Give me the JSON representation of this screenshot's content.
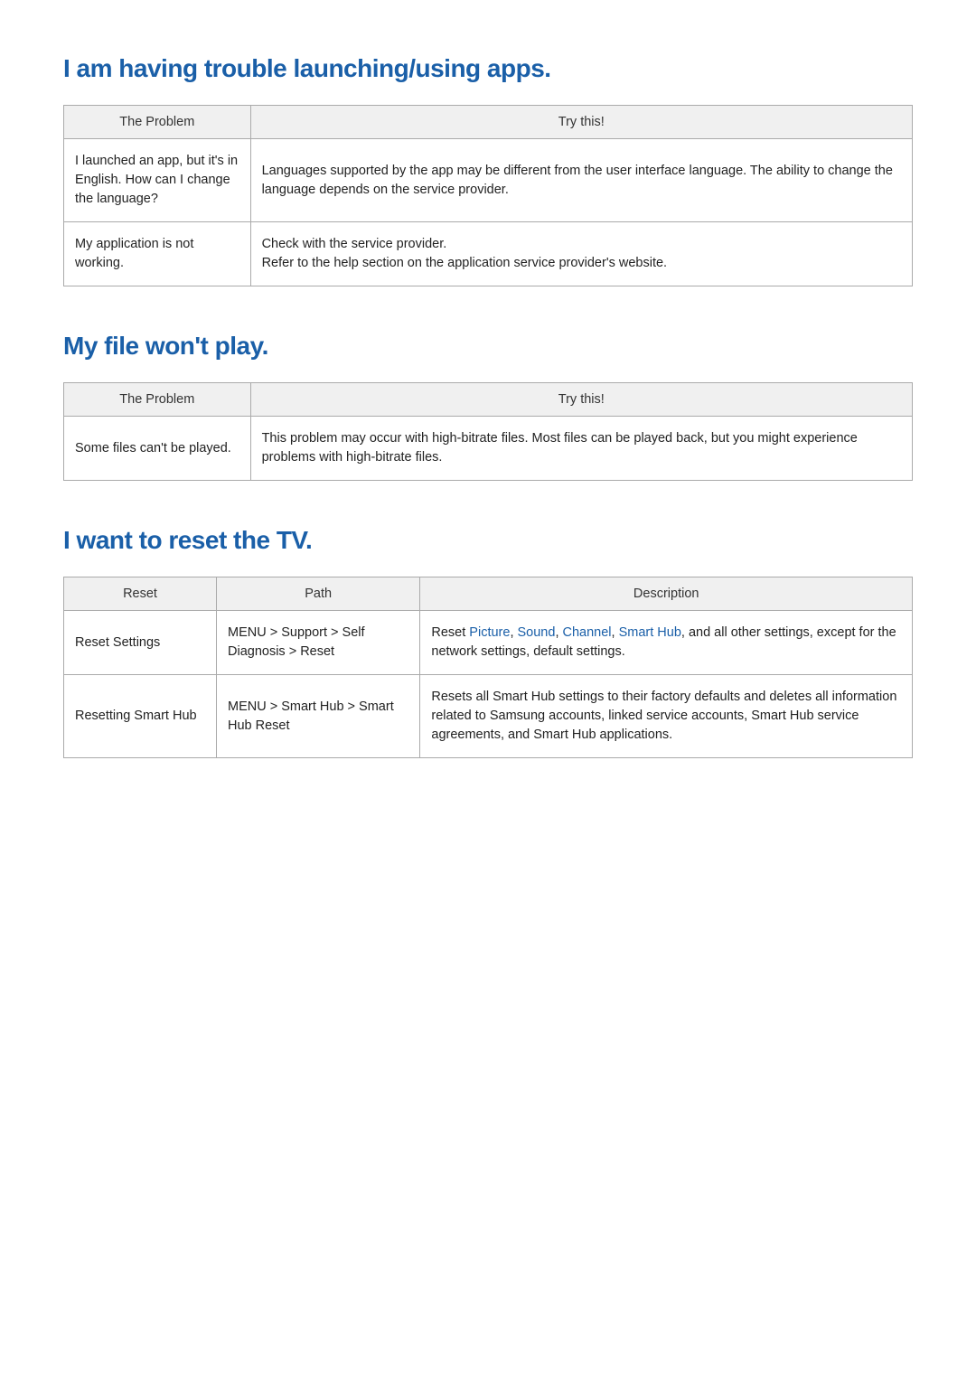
{
  "sections": {
    "apps": {
      "heading": "I am having trouble launching/using apps.",
      "headers": [
        "The Problem",
        "Try this!"
      ],
      "rows": [
        {
          "problem": "I launched an app, but it's in English. How can I change the language?",
          "solution": "Languages supported by the app may be different from the user interface language. The ability to change the language depends on the service provider."
        },
        {
          "problem": "My application is not working.",
          "solution": "Check with the service provider.\nRefer to the help section on the application service provider's website."
        }
      ]
    },
    "file": {
      "heading": "My file won't play.",
      "headers": [
        "The Problem",
        "Try this!"
      ],
      "rows": [
        {
          "problem": "Some files can't be played.",
          "solution": "This problem may occur with high-bitrate files. Most files can be played back, but you might experience problems with high-bitrate files."
        }
      ]
    },
    "reset": {
      "heading": "I want to reset the TV.",
      "headers": [
        "Reset",
        "Path",
        "Description"
      ],
      "rows": [
        {
          "name": "Reset Settings",
          "path_parts": [
            "MENU",
            "Support",
            "Self Diagnosis",
            "Reset"
          ],
          "desc_pre": "Reset ",
          "desc_terms": [
            "Picture",
            "Sound",
            "Channel",
            "Smart Hub"
          ],
          "desc_post": ", and all other settings, except for the network settings, default settings."
        },
        {
          "name": "Resetting Smart Hub",
          "path_parts": [
            "MENU",
            "Smart Hub",
            "Smart Hub Reset"
          ],
          "desc_plain": "Resets all Smart Hub settings to their factory defaults and deletes all information related to Samsung accounts, linked service accounts, Smart Hub service agreements, and Smart Hub applications."
        }
      ]
    }
  }
}
